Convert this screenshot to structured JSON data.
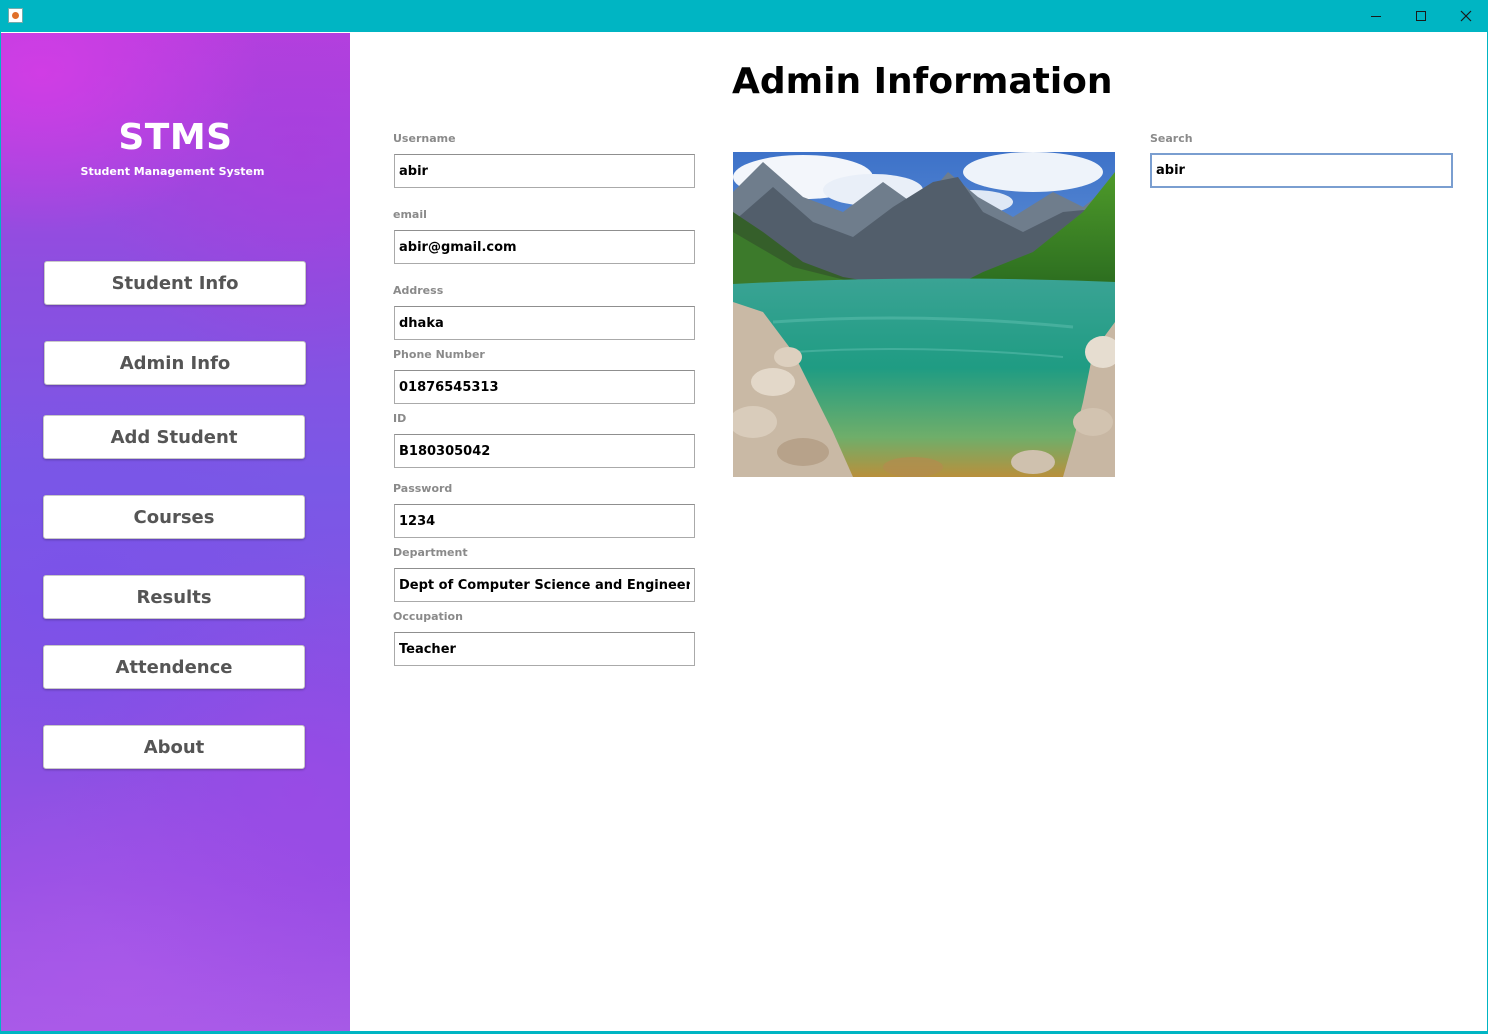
{
  "window": {
    "icon": "java-cup-icon",
    "controls": [
      "minimize-icon",
      "maximize-icon",
      "close-icon"
    ],
    "accent_color": "#00b5c3"
  },
  "sidebar": {
    "brand_title": "STMS",
    "brand_subtitle": "Student Management System",
    "items": [
      {
        "label": "Student Info"
      },
      {
        "label": "Admin Info"
      },
      {
        "label": "Add Student"
      },
      {
        "label": "Courses"
      },
      {
        "label": "Results"
      },
      {
        "label": "Attendence"
      },
      {
        "label": "About"
      }
    ]
  },
  "main": {
    "title": "Admin Information",
    "fields": [
      {
        "label": "Username",
        "value": "abir"
      },
      {
        "label": "email",
        "value": "abir@gmail.com"
      },
      {
        "label": "Address",
        "value": "dhaka"
      },
      {
        "label": "Phone Number",
        "value": "01876545313"
      },
      {
        "label": "ID",
        "value": "B180305042"
      },
      {
        "label": "Password",
        "value": "1234"
      },
      {
        "label": "Department",
        "value": "Dept of Computer Science and Engineering"
      },
      {
        "label": "Occupation",
        "value": "Teacher"
      }
    ],
    "search": {
      "label": "Search",
      "value": "abir"
    },
    "photo": "mountain-lake-landscape-image"
  }
}
